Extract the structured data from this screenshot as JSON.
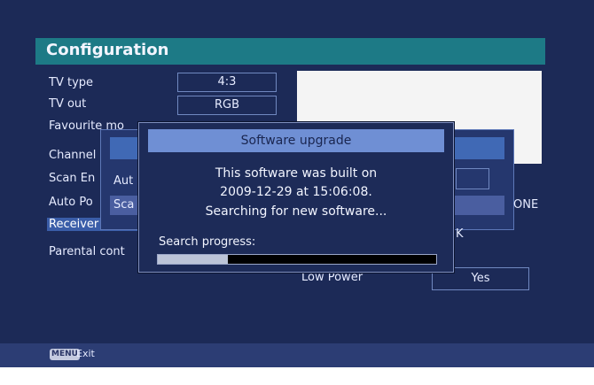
{
  "header": {
    "title": "Configuration"
  },
  "menu": {
    "tv_type_label": "TV type",
    "tv_out_label": "TV out",
    "favourite_label": "Favourite mo",
    "channel_label": "Channel",
    "scan_label": "Scan En",
    "autopower_label": "Auto Po",
    "receiver_label": "Receiver upgr",
    "parental_label": "Parental cont"
  },
  "fields": {
    "tv_type_value": "4:3",
    "tv_out_value": "RGB"
  },
  "submenu": {
    "auto_label": "Aut",
    "scan_label": "Sca"
  },
  "side": {
    "one_text": "ONE",
    "k_text": "K",
    "low_power_label": "Low Power",
    "yes_value": "Yes"
  },
  "dialog": {
    "title": "Software upgrade",
    "line1": "This software was built on",
    "line2": "2009-12-29 at 15:06:08.",
    "line3": "Searching for new software...",
    "progress_label": "Search progress:",
    "progress_fraction": 0.25
  },
  "footer": {
    "menu_key": "MENU",
    "exit_label": "Exit"
  },
  "colors": {
    "background": "#1c2a57",
    "title_bar": "#1d7a86",
    "highlight": "#3a5da8",
    "dialog_header": "#6f8fd4"
  }
}
